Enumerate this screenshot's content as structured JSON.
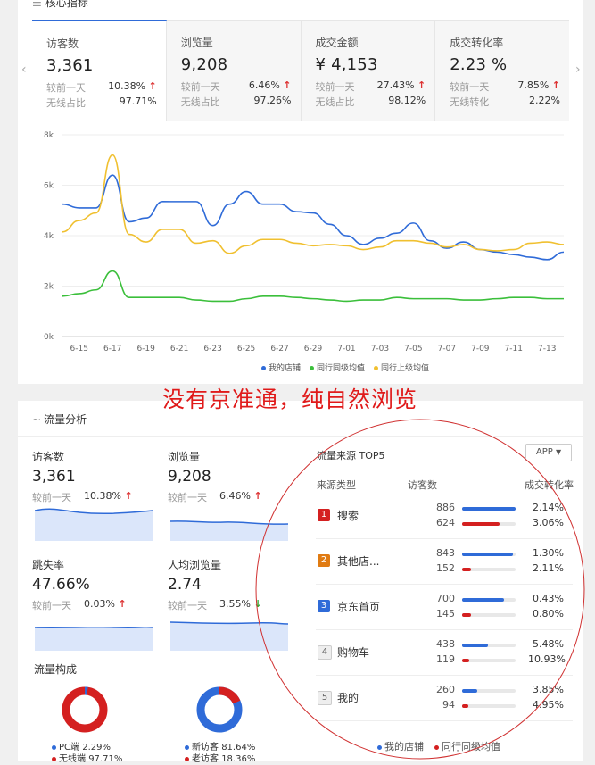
{
  "top": {
    "section_title": "核心指标",
    "kpis": [
      {
        "title": "访客数",
        "value": "3,361",
        "cmp_label": "较前一天",
        "cmp_value": "10.38%",
        "cmp_dir": "up",
        "share_label": "无线占比",
        "share_value": "97.71%"
      },
      {
        "title": "浏览量",
        "value": "9,208",
        "cmp_label": "较前一天",
        "cmp_value": "6.46%",
        "cmp_dir": "up",
        "share_label": "无线占比",
        "share_value": "97.26%"
      },
      {
        "title": "成交金额",
        "value": "¥ 4,153",
        "cmp_label": "较前一天",
        "cmp_value": "27.43%",
        "cmp_dir": "up",
        "share_label": "无线占比",
        "share_value": "98.12%"
      },
      {
        "title": "成交转化率",
        "value": "2.23 %",
        "cmp_label": "较前一天",
        "cmp_value": "7.85%",
        "cmp_dir": "up",
        "share_label": "无线转化",
        "share_value": "2.22%"
      }
    ],
    "nav_prev": "‹",
    "nav_next": "›"
  },
  "chart_data": {
    "type": "line",
    "x": [
      "6-14",
      "6-15",
      "6-16",
      "6-17",
      "6-18",
      "6-19",
      "6-20",
      "6-21",
      "6-22",
      "6-23",
      "6-24",
      "6-25",
      "6-26",
      "6-27",
      "6-28",
      "6-29",
      "6-30",
      "7-01",
      "7-02",
      "7-03",
      "7-04",
      "7-05",
      "7-06",
      "7-07",
      "7-08",
      "7-09",
      "7-10",
      "7-11",
      "7-12",
      "7-13",
      "7-14"
    ],
    "x_tick_labels": [
      "6-15",
      "6-17",
      "6-19",
      "6-21",
      "6-23",
      "6-25",
      "6-27",
      "6-29",
      "7-01",
      "7-03",
      "7-05",
      "7-07",
      "7-09",
      "7-11",
      "7-13"
    ],
    "y_tick_labels": [
      "0k",
      "2k",
      "4k",
      "6k",
      "8k"
    ],
    "ylim": [
      0,
      8000
    ],
    "series": [
      {
        "name": "我的店铺",
        "color": "#2f6bd8",
        "values": [
          5250,
          5100,
          5100,
          6400,
          4550,
          4700,
          5350,
          5350,
          5350,
          4400,
          5250,
          5750,
          5250,
          5250,
          4950,
          4900,
          4450,
          4000,
          3650,
          3900,
          4100,
          4500,
          3800,
          3500,
          3750,
          3450,
          3350,
          3250,
          3150,
          3050,
          3350
        ]
      },
      {
        "name": "同行同级均值",
        "color": "#3bbf3b",
        "values": [
          1600,
          1700,
          1850,
          2600,
          1550,
          1550,
          1550,
          1550,
          1450,
          1400,
          1400,
          1500,
          1600,
          1600,
          1550,
          1500,
          1450,
          1400,
          1450,
          1450,
          1550,
          1500,
          1500,
          1500,
          1450,
          1450,
          1500,
          1550,
          1550,
          1500,
          1500
        ]
      },
      {
        "name": "同行上级均值",
        "color": "#f0c030",
        "values": [
          4150,
          4600,
          4900,
          7200,
          4050,
          3750,
          4250,
          4250,
          3700,
          3800,
          3300,
          3600,
          3850,
          3850,
          3700,
          3600,
          3650,
          3600,
          3450,
          3550,
          3800,
          3800,
          3700,
          3550,
          3650,
          3450,
          3400,
          3450,
          3700,
          3750,
          3650
        ]
      }
    ]
  },
  "annotation": "没有京准通，纯自然浏览",
  "flow": {
    "section_title": "流量分析",
    "metrics": [
      {
        "title": "访客数",
        "value": "3,361",
        "cmp_label": "较前一天",
        "cmp_value": "10.38%",
        "cmp_dir": "up"
      },
      {
        "title": "浏览量",
        "value": "9,208",
        "cmp_label": "较前一天",
        "cmp_value": "6.46%",
        "cmp_dir": "up"
      },
      {
        "title": "跳失率",
        "value": "47.66%",
        "cmp_label": "较前一天",
        "cmp_value": "0.03%",
        "cmp_dir": "up"
      },
      {
        "title": "人均浏览量",
        "value": "2.74",
        "cmp_label": "较前一天",
        "cmp_value": "3.55%",
        "cmp_dir": "down"
      }
    ],
    "composition_title": "流量构成",
    "donut1": {
      "legend": [
        {
          "label": "PC端",
          "value": "2.29%",
          "color": "#2f6bd8"
        },
        {
          "label": "无线端",
          "value": "97.71%",
          "color": "#d42020"
        }
      ]
    },
    "donut2": {
      "legend": [
        {
          "label": "新访客",
          "value": "81.64%",
          "color": "#2f6bd8"
        },
        {
          "label": "老访客",
          "value": "18.36%",
          "color": "#d42020"
        }
      ]
    }
  },
  "sources": {
    "title": "流量来源 TOP5",
    "platform": "APP",
    "col_type": "来源类型",
    "col_visitors": "访客数",
    "col_rate": "成交转化率",
    "rows": [
      {
        "rank": "1",
        "name": "搜索",
        "mine": "886",
        "peer": "624",
        "mine_rate": "2.14%",
        "peer_rate": "3.06%",
        "mine_frac": 1.0,
        "peer_frac": 0.7,
        "color": "#d42020"
      },
      {
        "rank": "2",
        "name": "其他店...",
        "mine": "843",
        "peer": "152",
        "mine_rate": "1.30%",
        "peer_rate": "2.11%",
        "mine_frac": 0.95,
        "peer_frac": 0.17,
        "color": "#e07b12"
      },
      {
        "rank": "3",
        "name": "京东首页",
        "mine": "700",
        "peer": "145",
        "mine_rate": "0.43%",
        "peer_rate": "0.80%",
        "mine_frac": 0.79,
        "peer_frac": 0.16,
        "color": "#2f6bd8"
      },
      {
        "rank": "4",
        "name": "购物车",
        "mine": "438",
        "peer": "119",
        "mine_rate": "5.48%",
        "peer_rate": "10.93%",
        "mine_frac": 0.49,
        "peer_frac": 0.13,
        "color": "#cccccc"
      },
      {
        "rank": "5",
        "name": "我的",
        "mine": "260",
        "peer": "94",
        "mine_rate": "3.85%",
        "peer_rate": "4.95%",
        "mine_frac": 0.29,
        "peer_frac": 0.11,
        "color": "#cccccc"
      }
    ],
    "legend": [
      {
        "label": "我的店铺",
        "color": "#2f6bd8"
      },
      {
        "label": "同行同级均值",
        "color": "#d42020"
      }
    ]
  }
}
